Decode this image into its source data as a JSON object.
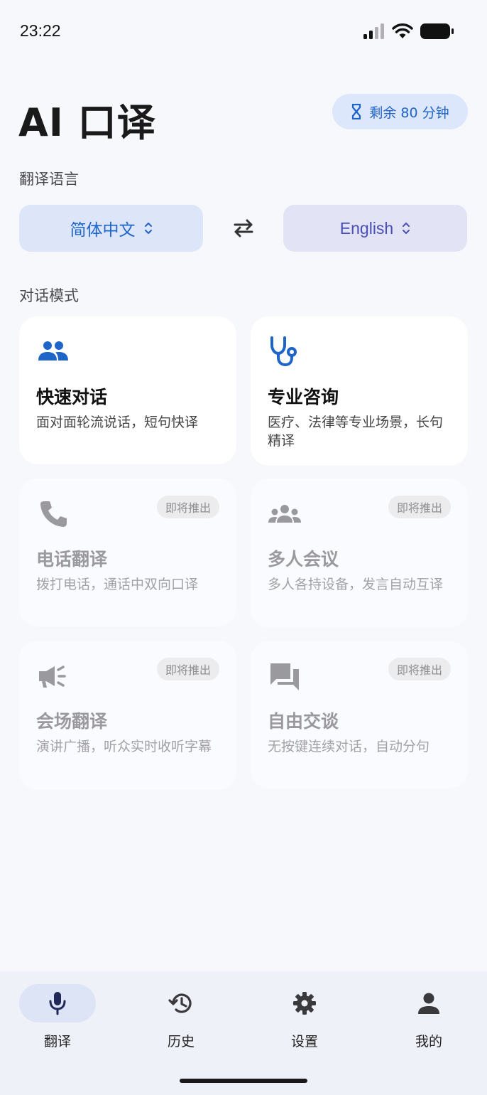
{
  "status_bar": {
    "time": "23:22"
  },
  "header": {
    "title": "AI 口译",
    "quota": "剩余 80 分钟"
  },
  "language": {
    "section_label": "翻译语言",
    "source": "简体中文",
    "target": "English"
  },
  "modes": {
    "section_label": "对话模式",
    "soon_label": "即将推出",
    "items": [
      {
        "title": "快速对话",
        "desc": "面对面轮流说话，短句快译",
        "icon": "people-icon",
        "available": true
      },
      {
        "title": "专业咨询",
        "desc": "医疗、法律等专业场景，长句精译",
        "icon": "stethoscope-icon",
        "available": true
      },
      {
        "title": "电话翻译",
        "desc": "拨打电话，通话中双向口译",
        "icon": "phone-icon",
        "available": false
      },
      {
        "title": "多人会议",
        "desc": "多人各持设备，发言自动互译",
        "icon": "groups-icon",
        "available": false
      },
      {
        "title": "会场翻译",
        "desc": "演讲广播，听众实时收听字幕",
        "icon": "megaphone-icon",
        "available": false
      },
      {
        "title": "自由交谈",
        "desc": "无按键连续对话，自动分句",
        "icon": "chat-icon",
        "available": false
      }
    ]
  },
  "tabs": [
    {
      "label": "翻译",
      "icon": "mic-icon",
      "active": true
    },
    {
      "label": "历史",
      "icon": "history-icon",
      "active": false
    },
    {
      "label": "设置",
      "icon": "gear-icon",
      "active": false
    },
    {
      "label": "我的",
      "icon": "person-icon",
      "active": false
    }
  ],
  "colors": {
    "accent": "#1f64c9",
    "accent_bg": "#dce6f8",
    "target_fg": "#4a4fb8",
    "disabled_text": "#9a9a9e"
  }
}
